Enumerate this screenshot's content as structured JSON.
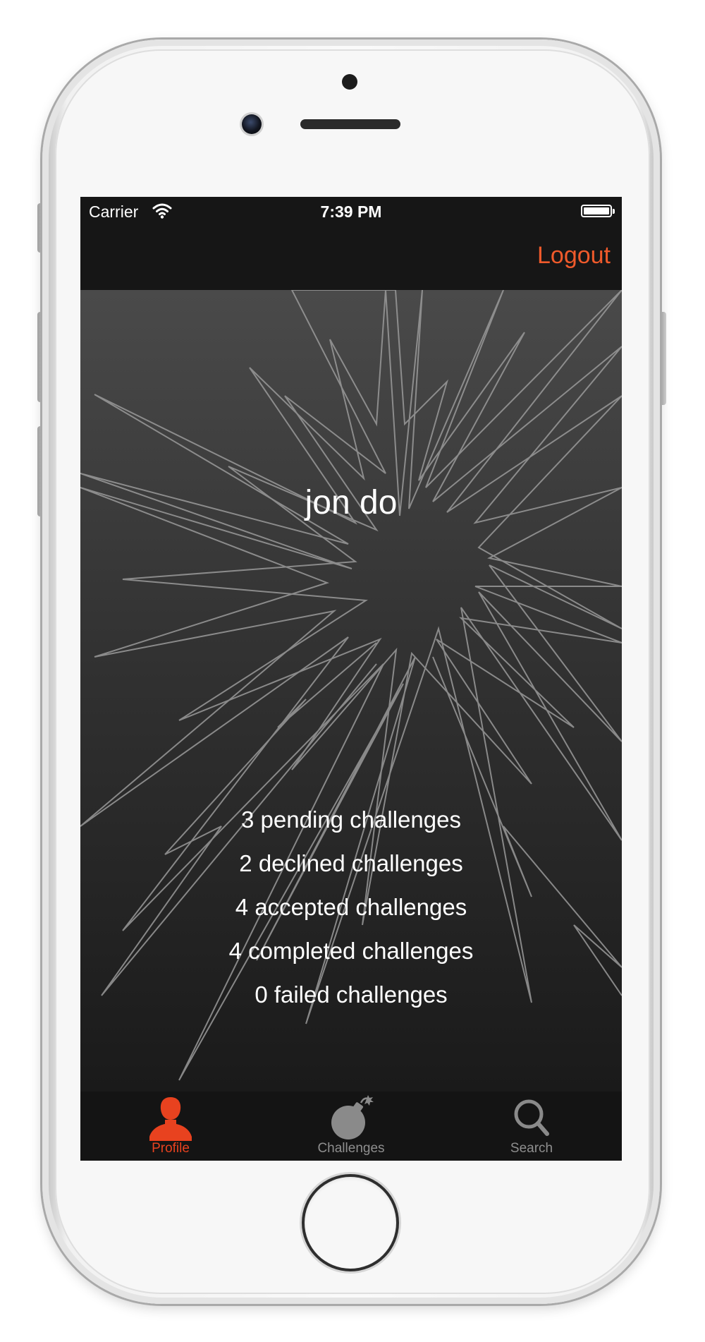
{
  "status_bar": {
    "carrier": "Carrier",
    "time": "7:39 PM"
  },
  "nav": {
    "logout_label": "Logout"
  },
  "profile": {
    "name": "jon do"
  },
  "stats": [
    "3 pending challenges",
    "2 declined challenges",
    "4 accepted challenges",
    "4 completed challenges",
    "0 failed challenges"
  ],
  "tabs": [
    {
      "label": "Profile",
      "icon": "person-icon",
      "active": true
    },
    {
      "label": "Challenges",
      "icon": "bomb-icon",
      "active": false
    },
    {
      "label": "Search",
      "icon": "magnifier-icon",
      "active": false
    }
  ],
  "colors": {
    "accent": "#ef5a2b",
    "active_tab": "#e8421f",
    "inactive_tab": "#8e8e8e",
    "bar_background": "#161616",
    "text": "#ffffff"
  }
}
